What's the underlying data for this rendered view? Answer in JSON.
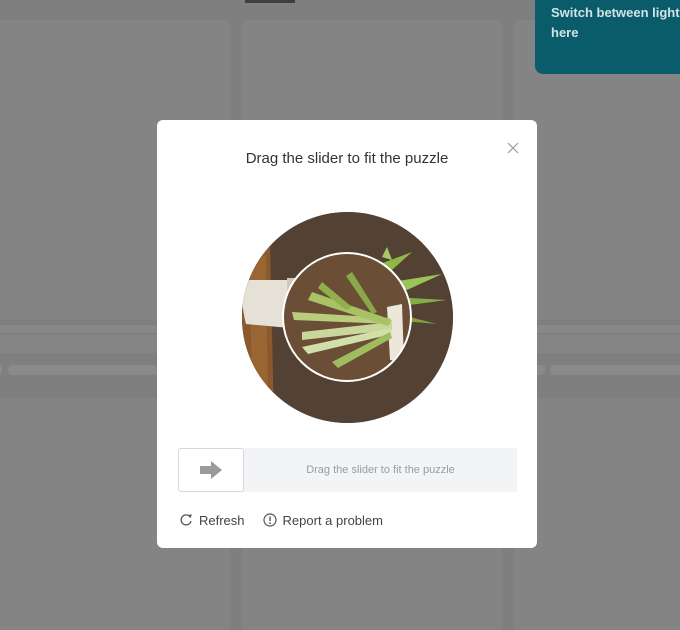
{
  "tooltip": {
    "line1": "Switch between light",
    "line2": "here"
  },
  "captcha": {
    "title": "Drag the slider to fit the puzzle",
    "slider_hint": "Drag the slider to fit the puzzle",
    "refresh_label": "Refresh",
    "report_label": "Report a problem",
    "close_icon": "close-icon",
    "handle_icon": "arrow-right-icon",
    "refresh_icon": "refresh-icon",
    "report_icon": "info-circle-icon",
    "slider_position": 0
  },
  "colors": {
    "overlay": "#7f7f7f",
    "tooltip_bg": "#0b5c6b",
    "modal_bg": "#ffffff",
    "track_bg": "#f3f4f6"
  }
}
